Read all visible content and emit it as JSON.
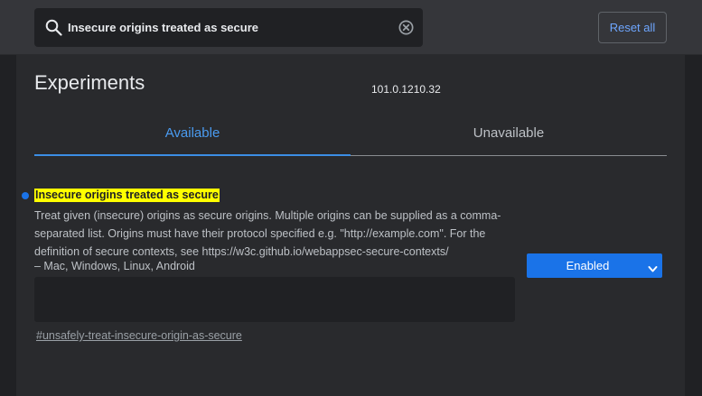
{
  "search": {
    "value": "Insecure origins treated as secure",
    "icon": "search-icon",
    "clear_icon": "clear-icon"
  },
  "header": {
    "reset_label": "Reset all"
  },
  "page": {
    "title": "Experiments",
    "version": "101.0.1210.32"
  },
  "tabs": [
    {
      "label": "Available",
      "active": true
    },
    {
      "label": "Unavailable",
      "active": false
    }
  ],
  "experiment": {
    "name": "Insecure origins treated as secure",
    "description": "Treat given (insecure) origins as secure origins. Multiple origins can be supplied as a comma-separated list. Origins must have their protocol specified e.g. \"http://example.com\". For the definition of secure contexts, see https://w3c.github.io/webappsec-secure-contexts/",
    "platforms": "– Mac, Windows, Linux, Android",
    "textarea_value": "",
    "link": "#unsafely-treat-insecure-origin-as-secure",
    "selected_option": "Enabled"
  },
  "colors": {
    "accent": "#1a73e8",
    "highlight": "#ffff00",
    "background": "#202124",
    "panel": "#292a2d",
    "header": "#35363a"
  }
}
